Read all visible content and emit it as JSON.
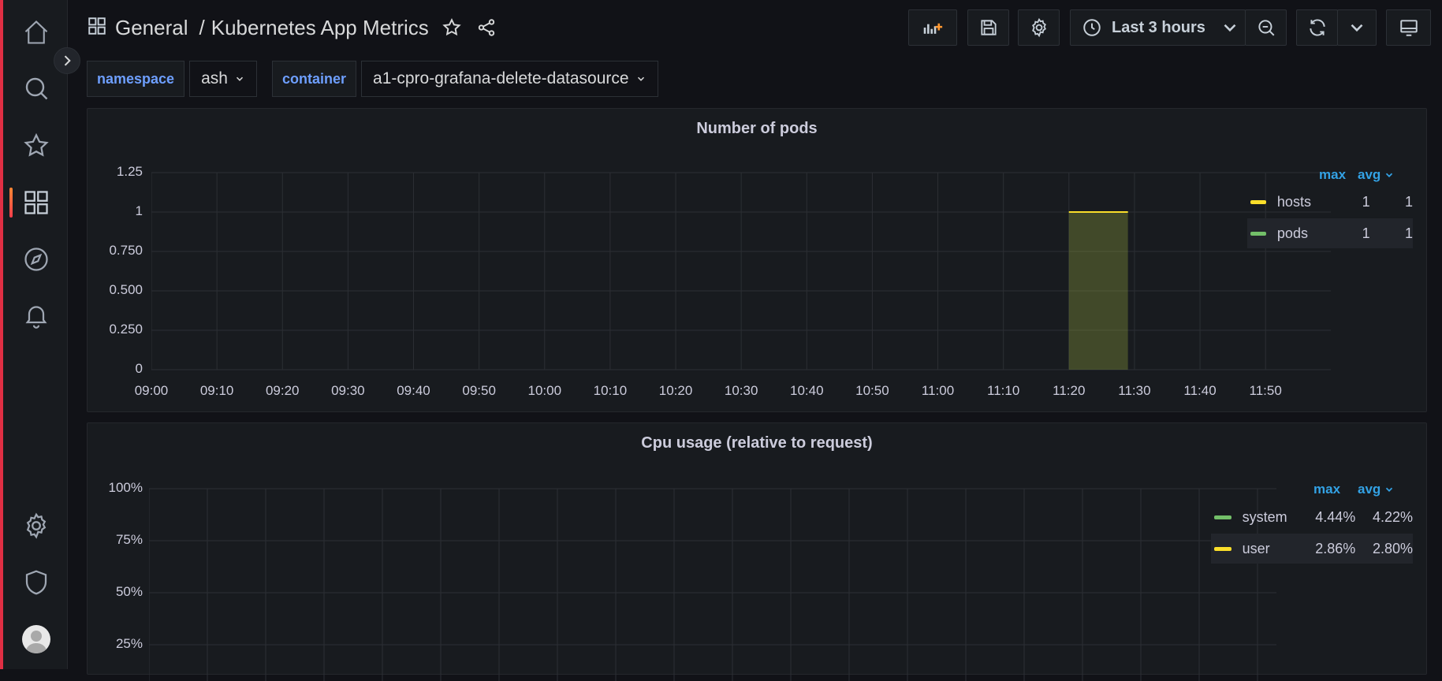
{
  "nav": {
    "items": [
      {
        "name": "home-icon"
      },
      {
        "name": "search-icon"
      },
      {
        "name": "star-icon"
      },
      {
        "name": "dashboards-icon",
        "active": true
      },
      {
        "name": "explore-icon"
      },
      {
        "name": "alerting-bell-icon"
      },
      {
        "name": "configuration-gear-icon"
      },
      {
        "name": "server-admin-shield-icon"
      }
    ]
  },
  "header": {
    "folder": "General",
    "separator": "/",
    "title": "Kubernetes App Metrics"
  },
  "toolbar": {
    "time_range": "Last 3 hours"
  },
  "variables": {
    "namespace": {
      "label": "namespace",
      "value": "ash"
    },
    "container": {
      "label": "container",
      "value": "a1-cpro-grafana-delete-datasource"
    }
  },
  "colors": {
    "yellow": "#fade2a",
    "green": "#73bf69",
    "accent_line": "#e02f44",
    "link_blue": "#33a2e5"
  },
  "panels": {
    "pods": {
      "title": "Number of pods",
      "legend": {
        "max_label": "max",
        "avg_label": "avg",
        "rows": [
          {
            "name": "hosts",
            "max": "1",
            "avg": "1",
            "color": "#fade2a"
          },
          {
            "name": "pods",
            "max": "1",
            "avg": "1",
            "color": "#73bf69"
          }
        ]
      }
    },
    "cpu": {
      "title": "Cpu usage (relative to request)",
      "legend": {
        "max_label": "max",
        "avg_label": "avg",
        "rows": [
          {
            "name": "system",
            "max": "4.44%",
            "avg": "4.22%",
            "color": "#73bf69"
          },
          {
            "name": "user",
            "max": "2.86%",
            "avg": "2.80%",
            "color": "#fade2a"
          }
        ]
      }
    }
  },
  "chart_data": [
    {
      "type": "area",
      "title": "Number of pods",
      "x": [
        "09:00",
        "09:10",
        "09:20",
        "09:30",
        "09:40",
        "09:50",
        "10:00",
        "10:10",
        "10:20",
        "10:30",
        "10:40",
        "10:50",
        "11:00",
        "11:10",
        "11:20",
        "11:30",
        "11:40",
        "11:50"
      ],
      "y_ticks": [
        "0",
        "0.250",
        "0.500",
        "0.750",
        "1",
        "1.25"
      ],
      "ylim": [
        0,
        1.25
      ],
      "grid": true,
      "legend_position": "right",
      "series": [
        {
          "name": "hosts",
          "color": "#fade2a",
          "points": [
            [
              "11:20",
              1
            ],
            [
              "11:29",
              1
            ]
          ]
        },
        {
          "name": "pods",
          "color": "#73bf69",
          "points": [
            [
              "11:20",
              1
            ],
            [
              "11:29",
              1
            ]
          ]
        }
      ]
    },
    {
      "type": "line",
      "title": "Cpu usage (relative to request)",
      "y_ticks": [
        "25%",
        "50%",
        "75%",
        "100%"
      ],
      "ylim": [
        0,
        100
      ],
      "grid": true,
      "legend_position": "right",
      "series": [
        {
          "name": "system",
          "color": "#73bf69"
        },
        {
          "name": "user",
          "color": "#fade2a"
        }
      ]
    }
  ]
}
